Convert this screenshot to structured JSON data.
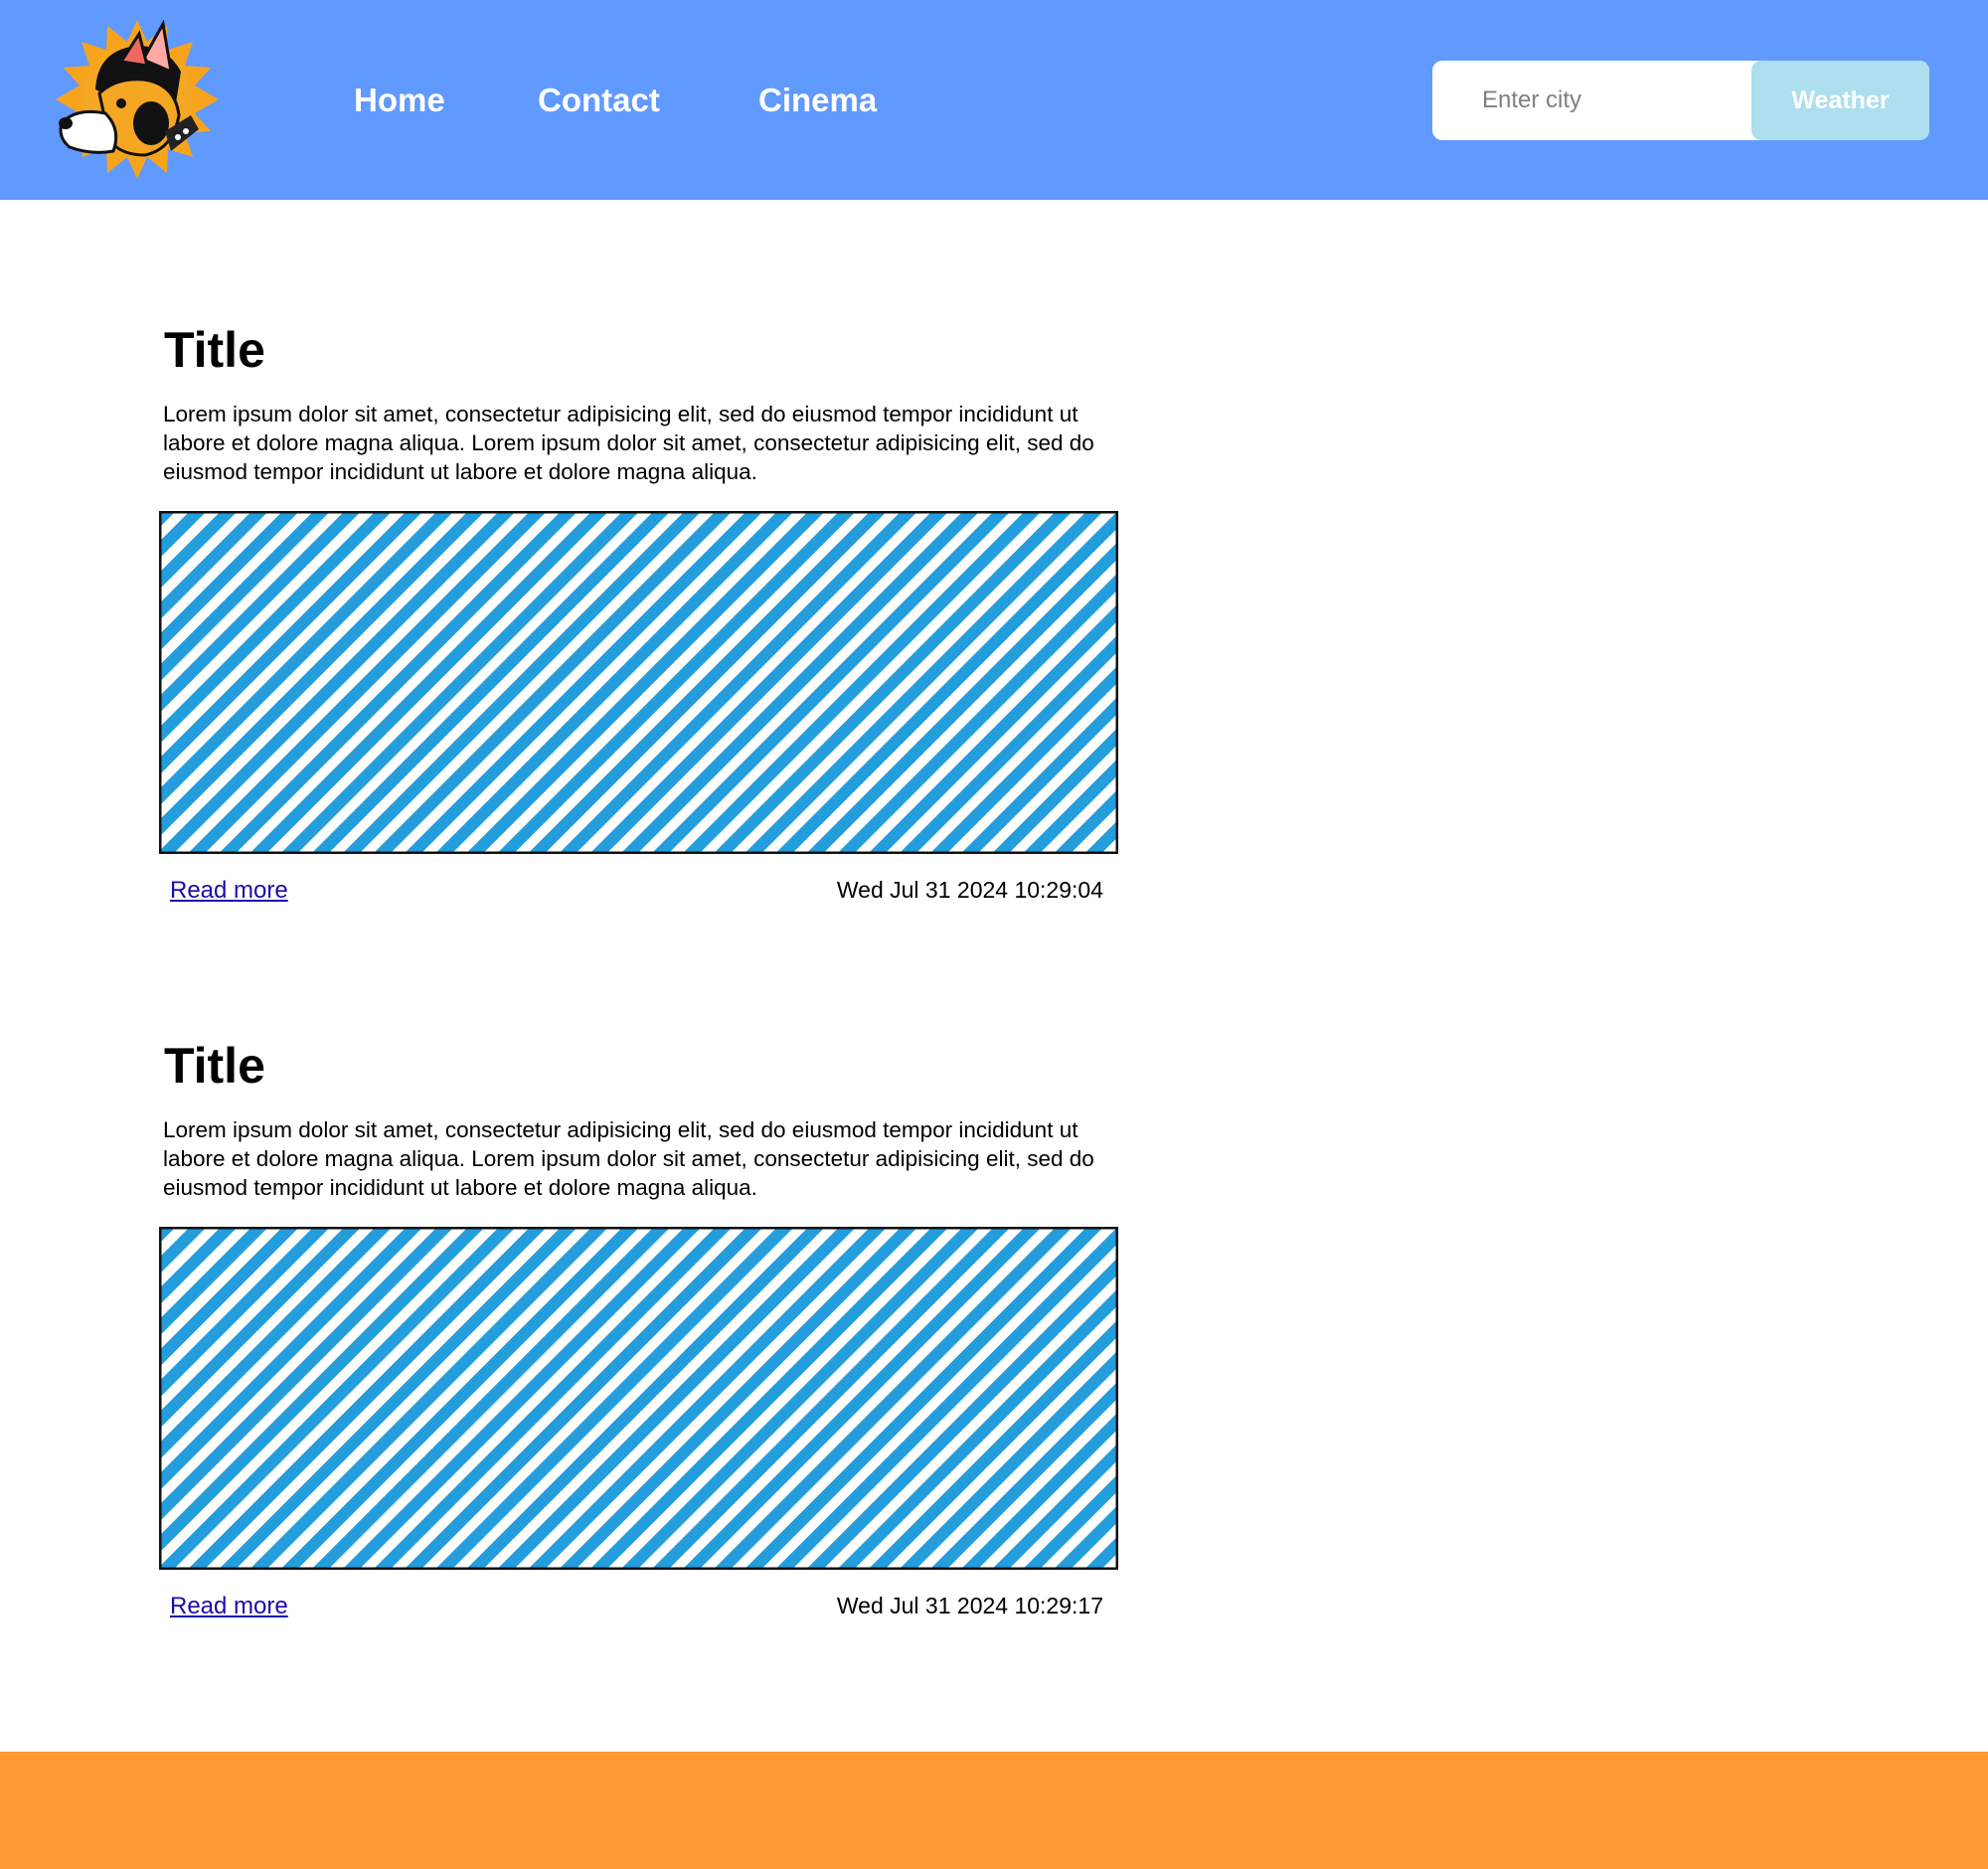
{
  "colors": {
    "header_bg": "#619afe",
    "footer_bg": "#ff9933",
    "button_bg": "#addfee",
    "image_stripe": "#249ddd",
    "link": "#1a0dab"
  },
  "header": {
    "logo_icon": "corgi-sun-logo",
    "nav": [
      {
        "label": "Home"
      },
      {
        "label": "Contact"
      },
      {
        "label": "Cinema"
      }
    ],
    "search": {
      "placeholder": "Enter city",
      "value": "",
      "button_label": "Weather"
    }
  },
  "articles": [
    {
      "title": "Title",
      "body": "Lorem ipsum dolor sit amet, consectetur adipisicing elit, sed do eiusmod tempor incididunt ut labore et dolore magna aliqua. Lorem ipsum dolor sit amet, consectetur adipisicing elit, sed do eiusmod tempor incididunt ut labore et dolore magna aliqua.",
      "image_icon": "striped-image-placeholder",
      "read_more": "Read more",
      "date": "Wed Jul 31 2024 10:29:04"
    },
    {
      "title": "Title",
      "body": "Lorem ipsum dolor sit amet, consectetur adipisicing elit, sed do eiusmod tempor incididunt ut labore et dolore magna aliqua. Lorem ipsum dolor sit amet, consectetur adipisicing elit, sed do eiusmod tempor incididunt ut labore et dolore magna aliqua.",
      "image_icon": "striped-image-placeholder",
      "read_more": "Read more",
      "date": "Wed Jul 31 2024 10:29:17"
    }
  ]
}
